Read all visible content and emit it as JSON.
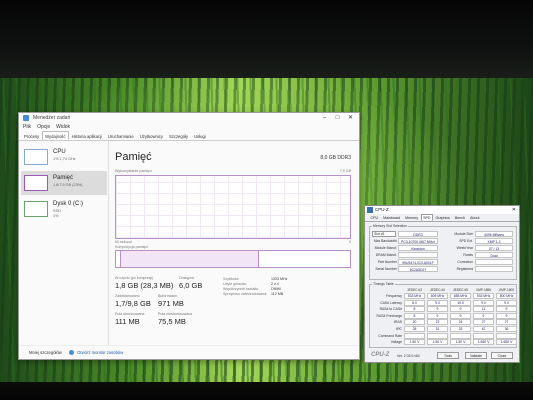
{
  "task_manager": {
    "title": "Menedżer zadań",
    "menu": [
      "Plik",
      "Opcje",
      "Widok"
    ],
    "tabs": [
      "Procesy",
      "Wydajność",
      "Historia aplikacji",
      "Uruchamianie",
      "Użytkownicy",
      "Szczegóły",
      "Usługi"
    ],
    "active_tab": "Wydajność",
    "sidebar": [
      {
        "name": "CPU",
        "sub": "1% 1,74 GHz",
        "sub2": ""
      },
      {
        "name": "Pamięć",
        "sub": "1,8/7,9 GB (23%)",
        "sub2": ""
      },
      {
        "name": "Dysk 0 (C:)",
        "sub": "SSD",
        "sub2": "1%"
      }
    ],
    "main": {
      "title": "Pamięć",
      "capacity": "8,0 GB DDR3",
      "graph_label": "Wykorzystanie pamięci",
      "graph_max": "7,9 GB",
      "graph_time": "60 sekund",
      "graph_min": "0",
      "composition_label": "Kompozycja pamięci"
    },
    "stats": {
      "in_use_label": "W użyciu (po kompresji)",
      "in_use_value": "1,8 GB (28,3 MB)",
      "available_label": "Dostępne",
      "available_value": "6,0 GB",
      "committed_label": "Zadeklarowano",
      "committed_value": "1,7/9,8 GB",
      "cached_label": "Buforowane",
      "cached_value": "971 MB",
      "paged_label": "Pula stronicowana",
      "paged_value": "111 MB",
      "nonpaged_label": "Pula niestronicowana",
      "nonpaged_value": "75,5 MB"
    },
    "info": [
      {
        "k": "Szybkość:",
        "v": "1333 MHz"
      },
      {
        "k": "Użyte gniazda:",
        "v": "2 z 4"
      },
      {
        "k": "Współczynnik kształtu:",
        "v": "DIMM"
      },
      {
        "k": "Sprzętowo zarezerwowana:",
        "v": "112 MB"
      }
    ],
    "footer": {
      "less": "Mniej szczegółów",
      "monitor": "Otwórz monitor zasobów"
    }
  },
  "cpuz": {
    "title": "CPU-Z",
    "tabs": [
      "CPU",
      "Mainboard",
      "Memory",
      "SPD",
      "Graphics",
      "Bench",
      "About"
    ],
    "active_tab": "SPD",
    "slot_group": "Memory Slot Selection",
    "slot": "Slot #1",
    "type": "DDR3",
    "rows_left": [
      {
        "label": "Max Bandwidth",
        "value": "PC3-10700 (667 MHz)"
      },
      {
        "label": "Module Manuf.",
        "value": "Kingston"
      },
      {
        "label": "DRAM Manuf.",
        "value": ""
      },
      {
        "label": "Part Number",
        "value": "99U5474-013.A00LF"
      },
      {
        "label": "Serial Number",
        "value": "6C2A5D27"
      }
    ],
    "rows_right": [
      {
        "label": "Module Size",
        "value": "4096 MBytes"
      },
      {
        "label": "SPD Ext.",
        "value": "XMP 1.2"
      },
      {
        "label": "Week/Year",
        "value": "07 / 13"
      },
      {
        "label": "Ranks",
        "value": "Dual"
      },
      {
        "label": "Correction",
        "value": ""
      },
      {
        "label": "Registered",
        "value": ""
      }
    ],
    "timings_group": "Timings Table",
    "timing_headers": [
      "JEDEC #3",
      "JEDEC #4",
      "JEDEC #5",
      "XMP-1866",
      "XMP-1600"
    ],
    "timings": [
      {
        "label": "Frequency",
        "values": [
          "533 MHz",
          "609 MHz",
          "685 MHz",
          "933 MHz",
          "800 MHz"
        ]
      },
      {
        "label": "CAS# Latency",
        "values": [
          "8.0",
          "9.0",
          "10.0",
          "9.0",
          "9.0"
        ]
      },
      {
        "label": "RAS# to CAS#",
        "values": [
          "8",
          "9",
          "9",
          "11",
          "9"
        ]
      },
      {
        "label": "RAS# Precharge",
        "values": [
          "8",
          "9",
          "9",
          "9",
          "9"
        ]
      },
      {
        "label": "tRAS",
        "values": [
          "20",
          "22",
          "24",
          "27",
          "27"
        ]
      },
      {
        "label": "tRC",
        "values": [
          "28",
          "31",
          "33",
          "42",
          "36"
        ]
      },
      {
        "label": "Command Rate",
        "values": [
          "",
          "",
          "",
          "",
          ""
        ]
      },
      {
        "label": "Voltage",
        "values": [
          "1.50 V",
          "1.50 V",
          "1.50 V",
          "1.650 V",
          "1.650 V"
        ]
      }
    ],
    "footer": {
      "logo": "CPU-Z",
      "version": "Ver. 2.03.0.x64",
      "tools": "Tools",
      "validate": "Validate",
      "close": "Close"
    }
  }
}
